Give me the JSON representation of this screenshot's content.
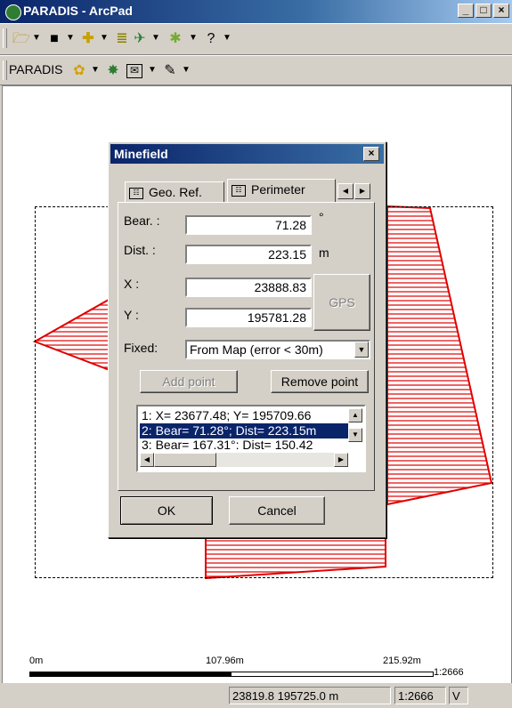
{
  "window": {
    "title": "PARADIS - ArcPad",
    "min": "_",
    "max": "□",
    "close": "×"
  },
  "toolbar2": {
    "label": "PARADIS"
  },
  "dialog": {
    "title": "Minefield",
    "close": "×",
    "tabs": [
      {
        "label": "Geo. Ref."
      },
      {
        "label": "Perimeter"
      }
    ],
    "bear": {
      "label": "Bear. :",
      "value": "71.28",
      "unit": "°"
    },
    "dist": {
      "label": "Dist. :",
      "value": "223.15",
      "unit": "m"
    },
    "x": {
      "label": "X :",
      "value": "23888.83"
    },
    "y": {
      "label": "Y :",
      "value": "195781.28"
    },
    "gps_label": "GPS",
    "fixed": {
      "label": "Fixed:",
      "value": "From Map (error < 30m)"
    },
    "add_point": "Add point",
    "remove_point": "Remove point",
    "points": [
      "1:  X= 23677.48; Y= 195709.66",
      "2:  Bear= 71.28°; Dist= 223.15m",
      "3:  Bear= 167.31°; Dist= 150.42"
    ],
    "ok": "OK",
    "cancel": "Cancel"
  },
  "scale": {
    "start": "0m",
    "mid": "107.96m",
    "end": "215.92m",
    "ratio": "1:2666"
  },
  "status": {
    "coords": "23819.8 195725.0 m",
    "scale": "1:2666",
    "mode": "V"
  }
}
